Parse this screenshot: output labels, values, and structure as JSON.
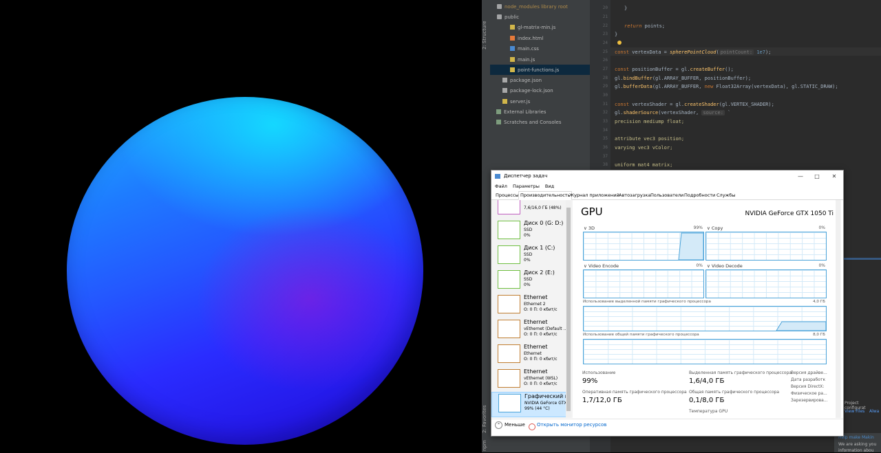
{
  "ide": {
    "sidebar_labels": [
      "2: Structure",
      "2: Favorites",
      "npm"
    ],
    "tree": [
      {
        "label": "node_modules  library root",
        "icon": "folder"
      },
      {
        "label": "public",
        "icon": "folder"
      },
      {
        "label": "gl-matrix-min.js",
        "icon": "js"
      },
      {
        "label": "index.html",
        "icon": "html"
      },
      {
        "label": "main.css",
        "icon": "css"
      },
      {
        "label": "main.js",
        "icon": "js"
      },
      {
        "label": "point-functions.js",
        "icon": "js"
      },
      {
        "label": "package.json",
        "icon": "json"
      },
      {
        "label": "package-lock.json",
        "icon": "json"
      },
      {
        "label": "server.js",
        "icon": "js"
      },
      {
        "label": "External Libraries",
        "icon": "lib"
      },
      {
        "label": "Scratches and Consoles",
        "icon": "lib"
      }
    ],
    "line_numbers": [
      "20",
      "21",
      "22",
      "23",
      "24",
      "25",
      "26",
      "27",
      "28",
      "29",
      "30",
      "31",
      "32",
      "33",
      "34",
      "35",
      "36",
      "37",
      "38",
      "39"
    ],
    "code": {
      "l1": "}",
      "l3_kw": "return",
      "l3_rest": " points;",
      "l4": "}",
      "l6_kw": "const",
      "l6_a": " vertexData = ",
      "l6_fn": "spherePointCloud",
      "l6_b": "(",
      "l6_hint": "pointCount:",
      "l6_num": " 1e7",
      "l6_c": ");",
      "l8_kw": "const",
      "l8_rest": " positionBuffer = gl.",
      "l8_fn": "createBuffer",
      "l8_end": "();",
      "l9_a": "gl.",
      "l9_fn": "bindBuffer",
      "l9_b": "(gl.ARRAY_BUFFER, positionBuffer);",
      "l10_a": "gl.",
      "l10_fn": "bufferData",
      "l10_b": "(gl.ARRAY_BUFFER, ",
      "l10_kw": "new",
      "l10_c": " Float32Array(vertexData), gl.STATIC_DRAW);",
      "l12_kw": "const",
      "l12_rest": " vertexShader = gl.",
      "l12_fn": "createShader",
      "l12_end": "(gl.VERTEX_SHADER);",
      "l13_a": "gl.",
      "l13_fn": "shaderSource",
      "l13_b": "(vertexShader, ",
      "l13_hint": "source:",
      "l13_c": " `",
      "l14": "precision mediump float;",
      "l16": "attribute vec3 position;",
      "l17": "varying vec3 vColor;",
      "l19": "uniform mat4 matrix;"
    },
    "right_panel": {
      "project_config": "Project configurat",
      "view_files": "View Files",
      "always": "Alwa"
    },
    "notification": {
      "title": "Help make Makin",
      "body": "We are asking you",
      "body2": "information abou"
    }
  },
  "task_manager": {
    "title": "Диспетчер задач",
    "menu": [
      "Файл",
      "Параметры",
      "Вид"
    ],
    "tabs": [
      "Процессы",
      "Производительность",
      "Журнал приложений",
      "Автозагрузка",
      "Пользователи",
      "Подробности",
      "Службы"
    ],
    "resources": [
      {
        "name": "",
        "sub1": "7,6/16,0 ГБ (48%)",
        "sub2": "",
        "sub3": "",
        "color": "#c060c0"
      },
      {
        "name": "Диск 0 (G: D:)",
        "sub1": "SSD",
        "sub2": "0%",
        "sub3": "",
        "color": "#6fbf40"
      },
      {
        "name": "Диск 1 (C:)",
        "sub1": "SSD",
        "sub2": "0%",
        "sub3": "",
        "color": "#6fbf40"
      },
      {
        "name": "Диск 2 (E:)",
        "sub1": "SSD",
        "sub2": "0%",
        "sub3": "",
        "color": "#6fbf40"
      },
      {
        "name": "Ethernet",
        "sub1": "Ethernet 2",
        "sub2": "О: 0 П: 0 кбит/с",
        "sub3": "",
        "color": "#c07d30"
      },
      {
        "name": "Ethernet",
        "sub1": "vEthernet (Default ...",
        "sub2": "О: 0 П: 0 кбит/с",
        "sub3": "",
        "color": "#c07d30"
      },
      {
        "name": "Ethernet",
        "sub1": "Ethernet",
        "sub2": "О: 0 П: 0 кбит/с",
        "sub3": "",
        "color": "#c07d30"
      },
      {
        "name": "Ethernet",
        "sub1": "vEthernet (WSL)",
        "sub2": "О: 0 П: 0 кбит/с",
        "sub3": "",
        "color": "#c07d30"
      },
      {
        "name": "Графический п",
        "sub1": "NVIDIA GeForce GTX",
        "sub2": "99% (44 °C)",
        "sub3": "",
        "color": "#4ba3d9"
      }
    ],
    "gpu": {
      "title": "GPU",
      "name": "NVIDIA GeForce GTX 1050 Ti",
      "engines": [
        {
          "label": "3D",
          "pct": "99%",
          "level": 0.99
        },
        {
          "label": "Copy",
          "pct": "0%",
          "level": 0
        },
        {
          "label": "Video Encode",
          "pct": "0%",
          "level": 0
        },
        {
          "label": "Video Decode",
          "pct": "0%",
          "level": 0
        }
      ],
      "dedicated_label": "Использование выделенной памяти графического процессора",
      "dedicated_max": "4,0 ГБ",
      "shared_label": "Использование общей памяти графического процессора",
      "shared_max": "8,0 ГБ",
      "stats": {
        "usage_label": "Использование",
        "usage_value": "99%",
        "ram_label": "Оперативная память графического процессора",
        "ram_value": "1,7/12,0 ГБ",
        "ded_label": "Выделенная память графического процессора",
        "ded_value": "1,6/4,0 ГБ",
        "shared_label": "Общая память графического процессора",
        "shared_value": "0,1/8,0 ГБ",
        "temp_label": "Температура GPU"
      },
      "info": [
        "Версия драйве...",
        "Дата разработк",
        "Версия DirectX:",
        "Физическое ра...",
        "Зарезервирова..."
      ]
    },
    "footer": {
      "less": "Меньше",
      "open_monitor": "Открыть монитор ресурсов"
    }
  }
}
